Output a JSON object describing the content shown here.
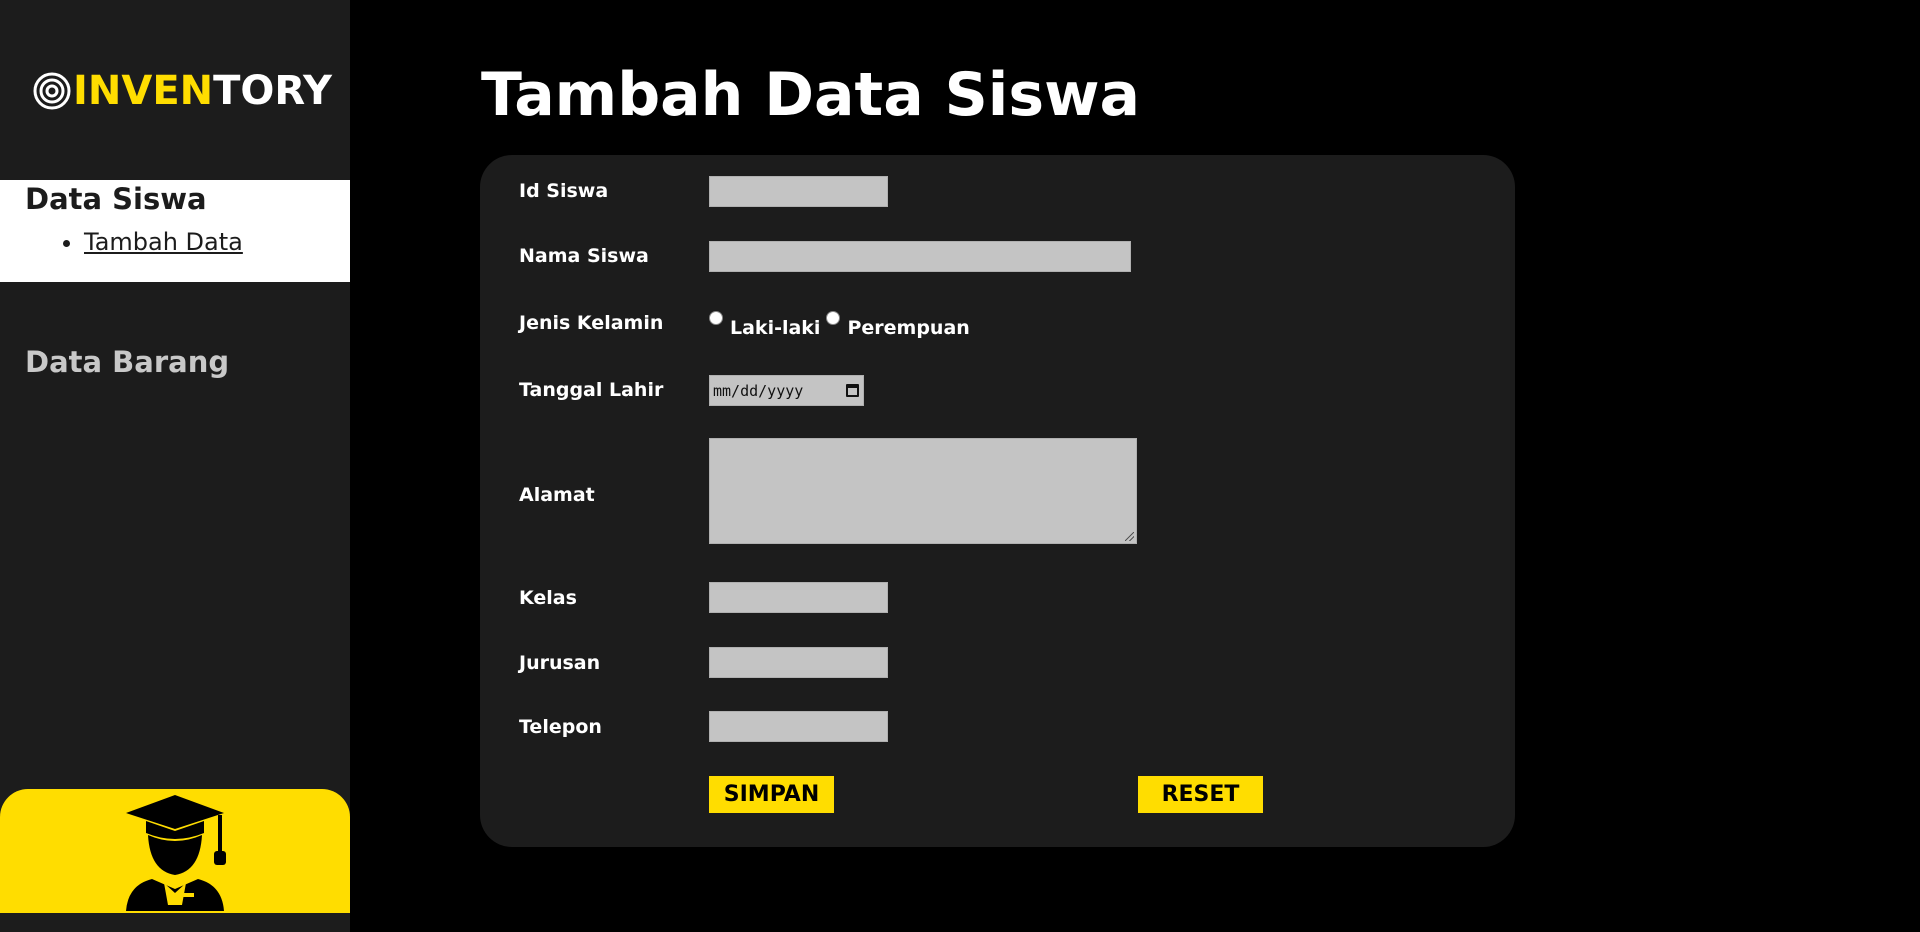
{
  "brand": {
    "name_part1": "INVEN",
    "name_part2": "TORY",
    "logo_icon": "target-icon",
    "accent_color": "#ffdd00"
  },
  "sidebar": {
    "active_section": "Data Siswa",
    "active_sub_item": "Tambah Data",
    "other_section": "Data Barang",
    "footer_icon": "graduate-student-icon"
  },
  "page": {
    "title": "Tambah Data Siswa"
  },
  "form": {
    "id_label": "Id Siswa",
    "id_value": "",
    "name_label": "Nama Siswa",
    "name_value": "",
    "gender_label": "Jenis Kelamin",
    "gender_options": [
      "Laki-laki",
      "Perempuan"
    ],
    "gender_selected": "",
    "birthdate_label": "Tanggal Lahir",
    "birthdate_placeholder": "mm/dd/yyyy",
    "address_label": "Alamat",
    "address_value": "",
    "class_label": "Kelas",
    "class_value": "",
    "major_label": "Jurusan",
    "major_value": "",
    "phone_label": "Telepon",
    "phone_value": "",
    "save_button": "SIMPAN",
    "reset_button": "RESET"
  }
}
